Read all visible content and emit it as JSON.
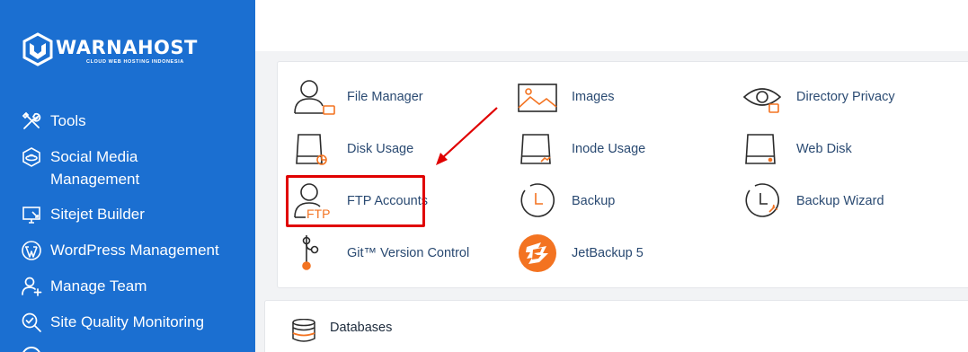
{
  "brand": {
    "name": "WARNAHOST",
    "tagline": "CLOUD WEB HOSTING INDONESIA"
  },
  "sidebar": {
    "items": [
      {
        "label": "Tools",
        "icon": "tools-icon"
      },
      {
        "label": "Social Media\nManagement",
        "icon": "social-media-icon"
      },
      {
        "label": "Sitejet Builder",
        "icon": "sitejet-icon"
      },
      {
        "label": "WordPress Management",
        "icon": "wordpress-icon"
      },
      {
        "label": "Manage Team",
        "icon": "manage-team-icon"
      },
      {
        "label": "Site Quality Monitoring",
        "icon": "site-quality-icon"
      }
    ]
  },
  "files": {
    "items": [
      {
        "label": "File Manager",
        "icon": "file-manager-icon"
      },
      {
        "label": "Images",
        "icon": "images-icon"
      },
      {
        "label": "Directory Privacy",
        "icon": "directory-privacy-icon"
      },
      {
        "label": "Disk Usage",
        "icon": "disk-usage-icon"
      },
      {
        "label": "Inode Usage",
        "icon": "inode-usage-icon"
      },
      {
        "label": "Web Disk",
        "icon": "web-disk-icon"
      },
      {
        "label": "FTP Accounts",
        "icon": "ftp-accounts-icon",
        "icon_text": "FTP"
      },
      {
        "label": "Backup",
        "icon": "backup-icon"
      },
      {
        "label": "Backup Wizard",
        "icon": "backup-wizard-icon"
      },
      {
        "label": "Git™ Version Control",
        "icon": "git-icon"
      },
      {
        "label": "JetBackup 5",
        "icon": "jetbackup-icon"
      }
    ]
  },
  "databases": {
    "title": "Databases",
    "icon": "database-icon"
  },
  "colors": {
    "sidebar": "#1b6fd1",
    "accent_orange": "#f37321",
    "highlight_red": "#e00000",
    "link_text": "#2a4a72"
  }
}
